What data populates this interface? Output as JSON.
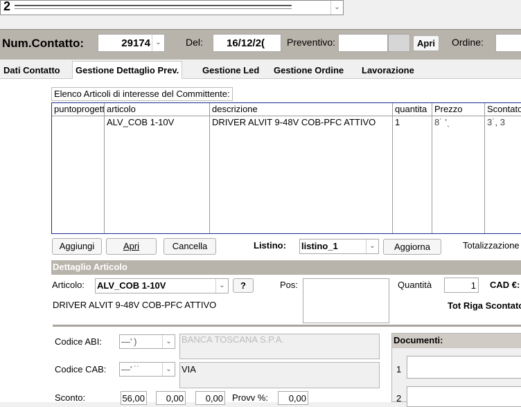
{
  "top_combo": {
    "value": "2"
  },
  "header": {
    "num_contatto_label": "Num.Contatto:",
    "num_contatto_value": "29174",
    "del_label": "Del:",
    "del_value": "16/12/2(",
    "preventivo_label": "Preventivo:",
    "preventivo_value": "",
    "apri_label": "Apri",
    "ordine_label": "Ordine:",
    "ordine_value": ""
  },
  "tabs": [
    {
      "label": "Dati Contatto",
      "active": false
    },
    {
      "label": "Gestione Dettaglio Prev.",
      "active": true
    },
    {
      "label": "Gestione Led",
      "active": false
    },
    {
      "label": "Gestione Ordine",
      "active": false
    },
    {
      "label": "Lavorazione",
      "active": false
    }
  ],
  "articles": {
    "title": "Elenco Articoli di interesse del Committente:",
    "columns": [
      "puntoprogetto",
      "articolo",
      "descrizione",
      "quantita",
      "Prezzo",
      "Scontato"
    ],
    "rows": [
      {
        "puntoprogetto": "",
        "articolo": "ALV_COB 1-10V",
        "descrizione": "DRIVER ALVIT 9-48V COB-PFC ATTIVO",
        "quantita": "1",
        "prezzo": "8˙ ’ˎ",
        "scontato": "3˙, 3"
      }
    ]
  },
  "actions": {
    "aggiungi": "Aggiungi",
    "apri": "Apri",
    "cancella": "Cancella",
    "listino_label": "Listino:",
    "listino_value": "listino_1",
    "aggiorna": "Aggiorna",
    "totalizzazione_label": "Totalizzazione"
  },
  "detail": {
    "section_title": "Dettaglio Articolo",
    "articolo_label": "Articolo:",
    "articolo_value": "ALV_COB 1-10V",
    "help_label": "?",
    "pos_label": "Pos:",
    "pos_value": "",
    "quantita_label": "Quantità",
    "quantita_value": "1",
    "cad_label": "CAD €:",
    "description": "DRIVER ALVIT 9-48V COB-PFC ATTIVO",
    "tot_riga_label": "Tot Riga Scontato"
  },
  "bank": {
    "abi_label": "Codice ABI:",
    "abi_value": "—' )",
    "abi_name": "BANCA TOSCANA S.P.A.",
    "cab_label": "Codice CAB:",
    "cab_value": "—' ˙˙",
    "cab_name": "VIA",
    "sconto_label": "Sconto:",
    "sconto_value": "56,00",
    "sconto2_value": "0,00",
    "sconto3_value": "0,00",
    "provv_label": "Provv %:",
    "provv_value": "0,00"
  },
  "documents": {
    "title": "Documenti:",
    "row1_label": "1",
    "row2_label": "2"
  },
  "colors": {
    "section_bg": "#b9b4ab",
    "grid_border": "#1a2c8c",
    "window_bg": "#f0f0f0"
  }
}
